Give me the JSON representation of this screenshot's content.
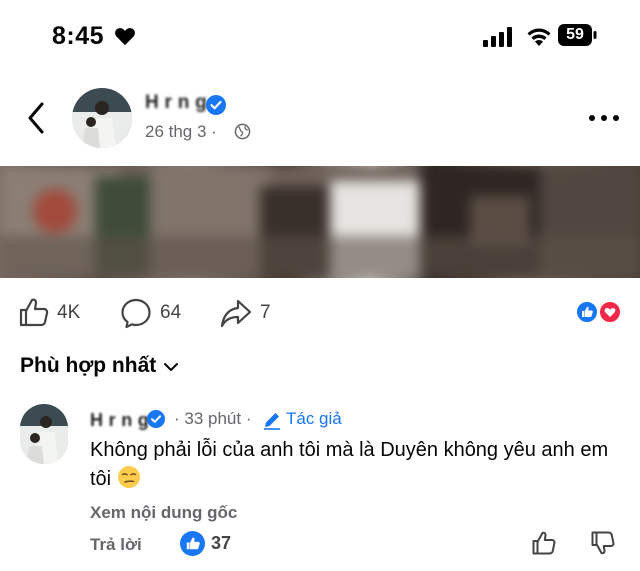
{
  "status_bar": {
    "time": "8:45",
    "battery": "59"
  },
  "post": {
    "author": "H r n g",
    "date": "26 thg 3 ·",
    "stats": {
      "likes": "4K",
      "comments": "64",
      "shares": "7"
    }
  },
  "sort": {
    "label": "Phù hợp nhất"
  },
  "comment": {
    "author": "H r n g",
    "time": "· 33 phút ·",
    "author_tag": "Tác giả",
    "text": "Không phải lỗi của anh tôi mà là Duyên không yêu anh em tôi",
    "see_original": "Xem nội dung gốc",
    "reply": "Trả lời",
    "likes": "37"
  },
  "colors": {
    "accent": "#1877f2",
    "secondary_text": "#65676b",
    "love": "#f02849"
  }
}
